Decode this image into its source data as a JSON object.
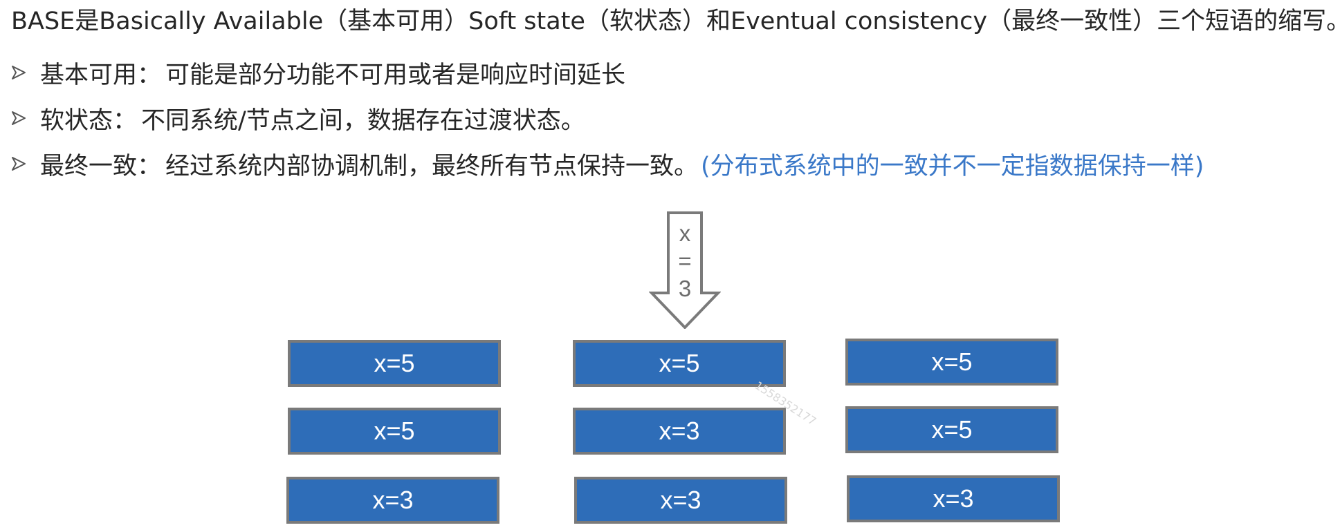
{
  "intro": "BASE是Basically Available（基本可用）Soft state（软状态）和Eventual consistency（最终一致性）三个短语的缩写。",
  "bullets": [
    {
      "label": "基本可用：",
      "text": "可能是部分功能不可用或者是响应时间延长",
      "note": ""
    },
    {
      "label": "软状态：",
      "text": "不同系统/节点之间，数据存在过渡状态。",
      "note": ""
    },
    {
      "label": "最终一致：",
      "text": "经过系统内部协调机制，最终所有节点保持一致。",
      "note": "(分布式系统中的一致并不一定指数据保持一样)"
    }
  ],
  "update_arrow": {
    "lines": [
      "x",
      "=",
      "3"
    ]
  },
  "grid": {
    "rows": [
      [
        "x=5",
        "x=5",
        "x=5"
      ],
      [
        "x=5",
        "x=3",
        "x=5"
      ],
      [
        "x=3",
        "x=3",
        "x=3"
      ]
    ]
  },
  "watermark": "1558352177",
  "colors": {
    "node_fill": "#2e6db8",
    "node_border": "#7a7a7a",
    "note_text": "#3a78c8",
    "arrow_stroke": "#7a7a7a"
  }
}
